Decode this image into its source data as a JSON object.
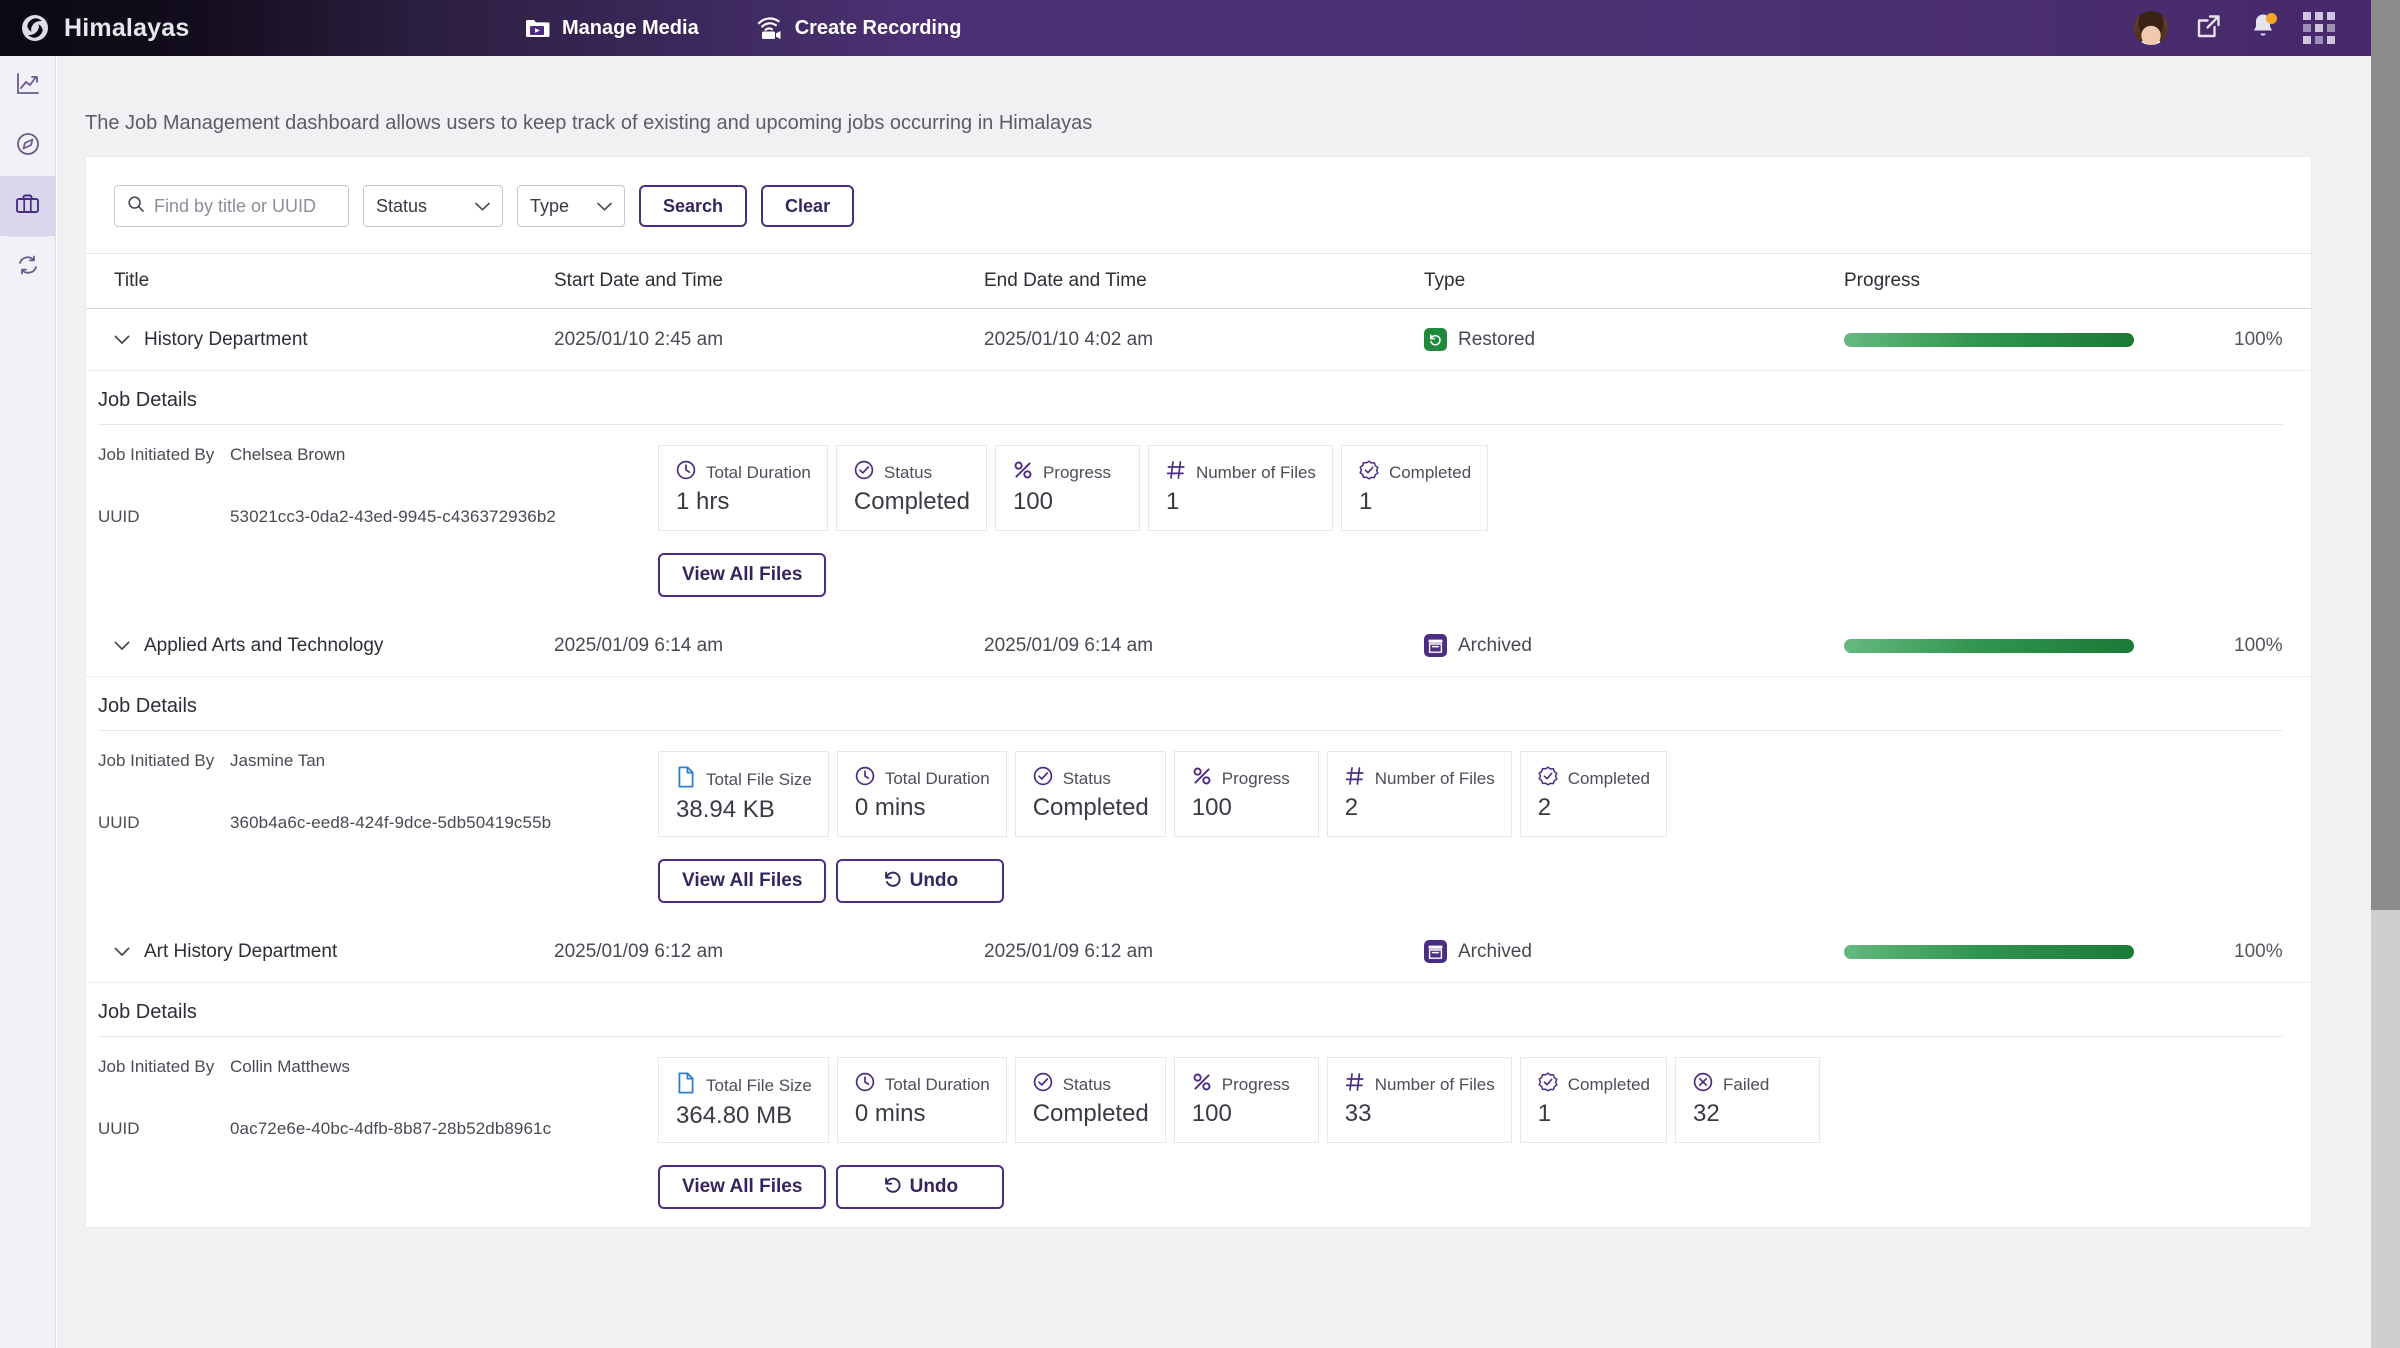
{
  "app": {
    "brand": "Himalayas",
    "logo_icon": "himalayas-swirl-logo",
    "nav": [
      {
        "label": "Manage Media",
        "icon": "folder-play-icon"
      },
      {
        "label": "Create Recording",
        "icon": "wifi-camera-icon"
      }
    ],
    "right_icons": [
      {
        "name": "user-avatar",
        "icon": "avatar-photo"
      },
      {
        "name": "open-external",
        "icon": "external-link-icon"
      },
      {
        "name": "notifications",
        "icon": "bell-icon",
        "has_badge": true
      },
      {
        "name": "app-launcher",
        "icon": "grid-apps-icon"
      }
    ]
  },
  "sidebar": {
    "items": [
      {
        "name": "analytics",
        "icon": "line-chart-icon",
        "active": false
      },
      {
        "name": "explore",
        "icon": "compass-icon",
        "active": false
      },
      {
        "name": "jobs",
        "icon": "briefcase-icon",
        "active": true
      },
      {
        "name": "sync",
        "icon": "sync-refresh-icon",
        "active": false
      }
    ]
  },
  "page": {
    "description": "The Job Management dashboard allows users to keep track of existing and upcoming jobs occurring in Himalayas"
  },
  "filters": {
    "search_placeholder": "Find by title or UUID",
    "search_value": "",
    "search_icon": "search-icon",
    "status_label": "Status",
    "type_label": "Type",
    "search_button": "Search",
    "clear_button": "Clear"
  },
  "table": {
    "columns": {
      "title": "Title",
      "start": "Start Date and Time",
      "end": "End Date and Time",
      "type": "Type",
      "progress": "Progress"
    }
  },
  "labels": {
    "job_details": "Job Details",
    "initiated_by": "Job Initiated By",
    "uuid": "UUID",
    "view_all_files": "View All Files",
    "undo": "Undo"
  },
  "jobs": [
    {
      "title": "History Department",
      "start": "2025/01/10 2:45 am",
      "end": "2025/01/10 4:02 am",
      "type": "Restored",
      "type_icon": "restore-arrow-icon",
      "type_color": "#1f8a3c",
      "progress_pct": "100%",
      "progress_value": 100,
      "initiated_by": "Chelsea Brown",
      "uuid": "53021cc3-0da2-43ed-9945-c436372936b2",
      "stats": [
        {
          "icon": "clock-icon",
          "label": "Total Duration",
          "value": "1 hrs"
        },
        {
          "icon": "check-circle-icon",
          "label": "Status",
          "value": "Completed"
        },
        {
          "icon": "percent-icon",
          "label": "Progress",
          "value": "100"
        },
        {
          "icon": "hash-icon",
          "label": "Number of Files",
          "value": "1"
        },
        {
          "icon": "check-seal-icon",
          "label": "Completed",
          "value": "1"
        }
      ],
      "actions": [
        "View All Files"
      ]
    },
    {
      "title": "Applied Arts and Technology",
      "start": "2025/01/09 6:14 am",
      "end": "2025/01/09 6:14 am",
      "type": "Archived",
      "type_icon": "archive-box-icon",
      "type_color": "#4b2e83",
      "progress_pct": "100%",
      "progress_value": 100,
      "initiated_by": "Jasmine Tan",
      "uuid": "360b4a6c-eed8-424f-9dce-5db50419c55b",
      "stats": [
        {
          "icon": "file-icon",
          "label": "Total File Size",
          "value": "38.94 KB"
        },
        {
          "icon": "clock-icon",
          "label": "Total Duration",
          "value": "0 mins"
        },
        {
          "icon": "check-circle-icon",
          "label": "Status",
          "value": "Completed"
        },
        {
          "icon": "percent-icon",
          "label": "Progress",
          "value": "100"
        },
        {
          "icon": "hash-icon",
          "label": "Number of Files",
          "value": "2"
        },
        {
          "icon": "check-seal-icon",
          "label": "Completed",
          "value": "2"
        }
      ],
      "actions": [
        "View All Files",
        "Undo"
      ]
    },
    {
      "title": "Art History Department",
      "start": "2025/01/09 6:12 am",
      "end": "2025/01/09 6:12 am",
      "type": "Archived",
      "type_icon": "archive-box-icon",
      "type_color": "#4b2e83",
      "progress_pct": "100%",
      "progress_value": 100,
      "initiated_by": "Collin Matthews",
      "uuid": "0ac72e6e-40bc-4dfb-8b87-28b52db8961c",
      "stats": [
        {
          "icon": "file-icon",
          "label": "Total File Size",
          "value": "364.80 MB"
        },
        {
          "icon": "clock-icon",
          "label": "Total Duration",
          "value": "0 mins"
        },
        {
          "icon": "check-circle-icon",
          "label": "Status",
          "value": "Completed"
        },
        {
          "icon": "percent-icon",
          "label": "Progress",
          "value": "100"
        },
        {
          "icon": "hash-icon",
          "label": "Number of Files",
          "value": "33"
        },
        {
          "icon": "check-seal-icon",
          "label": "Completed",
          "value": "1"
        },
        {
          "icon": "x-circle-icon",
          "label": "Failed",
          "value": "32"
        }
      ],
      "actions": [
        "View All Files",
        "Undo"
      ]
    }
  ],
  "colors": {
    "brand_purple": "#4b2e83",
    "header_dark": "#120d1c",
    "progress_green_light": "#66b97f",
    "progress_green_dark": "#1a7a36",
    "restored_green": "#1f8a3c",
    "file_blue": "#2f7fd1"
  }
}
